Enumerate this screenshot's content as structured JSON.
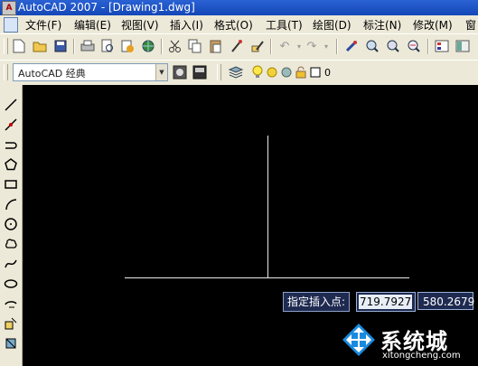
{
  "window": {
    "title": "AutoCAD 2007 - [Drawing1.dwg]",
    "app_icon_text": "A"
  },
  "menu": [
    {
      "id": "file",
      "label": "文件(F)"
    },
    {
      "id": "edit",
      "label": "编辑(E)"
    },
    {
      "id": "view",
      "label": "视图(V)"
    },
    {
      "id": "insert",
      "label": "插入(I)"
    },
    {
      "id": "format",
      "label": "格式(O)"
    },
    {
      "id": "tools",
      "label": "工具(T)"
    },
    {
      "id": "draw",
      "label": "绘图(D)"
    },
    {
      "id": "dimension",
      "label": "标注(N)"
    },
    {
      "id": "modify",
      "label": "修改(M)"
    },
    {
      "id": "window",
      "label": "窗"
    }
  ],
  "workspace": {
    "value": "AutoCAD 经典"
  },
  "layer": {
    "name": "0"
  },
  "dynamic_input": {
    "prompt": "指定插入点:",
    "x_value": "719.7927",
    "y_value": "580.2679"
  },
  "watermark": {
    "name": "系统城",
    "url": "xitongcheng.com"
  },
  "colors": {
    "titlebar": "#1447b8",
    "chrome": "#ece9d8",
    "canvas": "#000000",
    "crosshair": "#e8e8e8",
    "dyn_bg": "#1e2a50"
  }
}
